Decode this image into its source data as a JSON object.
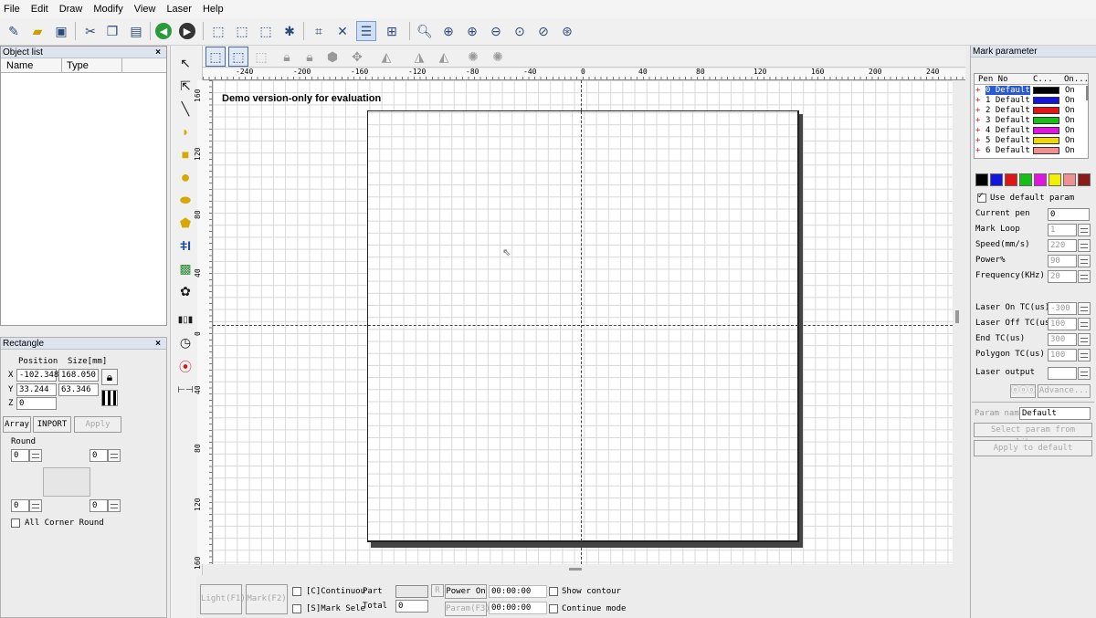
{
  "menu": [
    "File",
    "Edit",
    "Draw",
    "Modify",
    "View",
    "Laser",
    "Help"
  ],
  "object_list": {
    "title": "Object list",
    "columns": [
      "Name",
      "Type"
    ]
  },
  "rectangle": {
    "title": "Rectangle",
    "position_label": "Position",
    "size_label": "Size[mm]",
    "x_label": "X",
    "y_label": "Y",
    "z_label": "Z",
    "x": "-102.348",
    "y": "33.244",
    "z": "0",
    "width": "168.050",
    "height": "63.346",
    "array": "Array",
    "import": "INPORT",
    "apply": "Apply",
    "round_label": "Round",
    "round_tl": "0",
    "round_tr": "0",
    "round_bl": "0",
    "round_br": "0",
    "all_corner": "All Corner Round"
  },
  "canvas": {
    "demo_text": "Demo version-only for evaluation",
    "x_ticks": [
      "-240",
      "-200",
      "-160",
      "-120",
      "-80",
      "-40",
      "0",
      "40",
      "80",
      "120",
      "160",
      "200",
      "240"
    ],
    "y_ticks": [
      "160",
      "120",
      "80",
      "40",
      "0",
      "40",
      "80",
      "120",
      "160"
    ]
  },
  "bottom": {
    "light": "Light(F1)",
    "mark": "Mark(F2)",
    "continuous": "[C]Continuou",
    "mark_sele": "[S]Mark Sele",
    "part": "Part",
    "total": "Total",
    "total_val": "0",
    "r": "R",
    "power_on": "Power On",
    "param": "Param(F3)",
    "time1": "00:00:00",
    "time2": "00:00:00",
    "show_contour": "Show contour",
    "continue_mode": "Continue mode"
  },
  "mark_parameter": {
    "title": "Mark parameter",
    "columns": [
      "Pen No",
      "C...",
      "On..."
    ],
    "pens": [
      {
        "name": "0 Default",
        "color": "#000000",
        "on": "On"
      },
      {
        "name": "1 Default",
        "color": "#1515e0",
        "on": "On"
      },
      {
        "name": "2 Default",
        "color": "#e01515",
        "on": "On"
      },
      {
        "name": "3 Default",
        "color": "#15c015",
        "on": "On"
      },
      {
        "name": "4 Default",
        "color": "#e015e0",
        "on": "On"
      },
      {
        "name": "5 Default",
        "color": "#f0d800",
        "on": "On"
      },
      {
        "name": "6 Default",
        "color": "#f09090",
        "on": "On"
      }
    ],
    "palette": [
      "#000000",
      "#1515e0",
      "#e01515",
      "#15c015",
      "#e015e0",
      "#f0f000",
      "#f09090",
      "#8b1a1a"
    ],
    "use_default": "Use default param",
    "fields": [
      {
        "label": "Current pen",
        "value": "0"
      },
      {
        "label": "Mark Loop",
        "value": "1"
      },
      {
        "label": "Speed(mm/s)",
        "value": "220"
      },
      {
        "label": "Power%",
        "value": "90"
      },
      {
        "label": "Frequency(KHz)",
        "value": "20"
      },
      {
        "label": "Laser On TC(us)",
        "value": "-300"
      },
      {
        "label": "Laser Off TC(us",
        "value": "100"
      },
      {
        "label": "End TC(us)",
        "value": "300"
      },
      {
        "label": "Polygon TC(us)",
        "value": "100"
      },
      {
        "label": "Laser output",
        "value": ""
      }
    ],
    "advance": "Advance...",
    "param_name_label": "Param name",
    "param_name": "Default",
    "select_library": "Select param from library",
    "apply_default": "Apply to default"
  }
}
